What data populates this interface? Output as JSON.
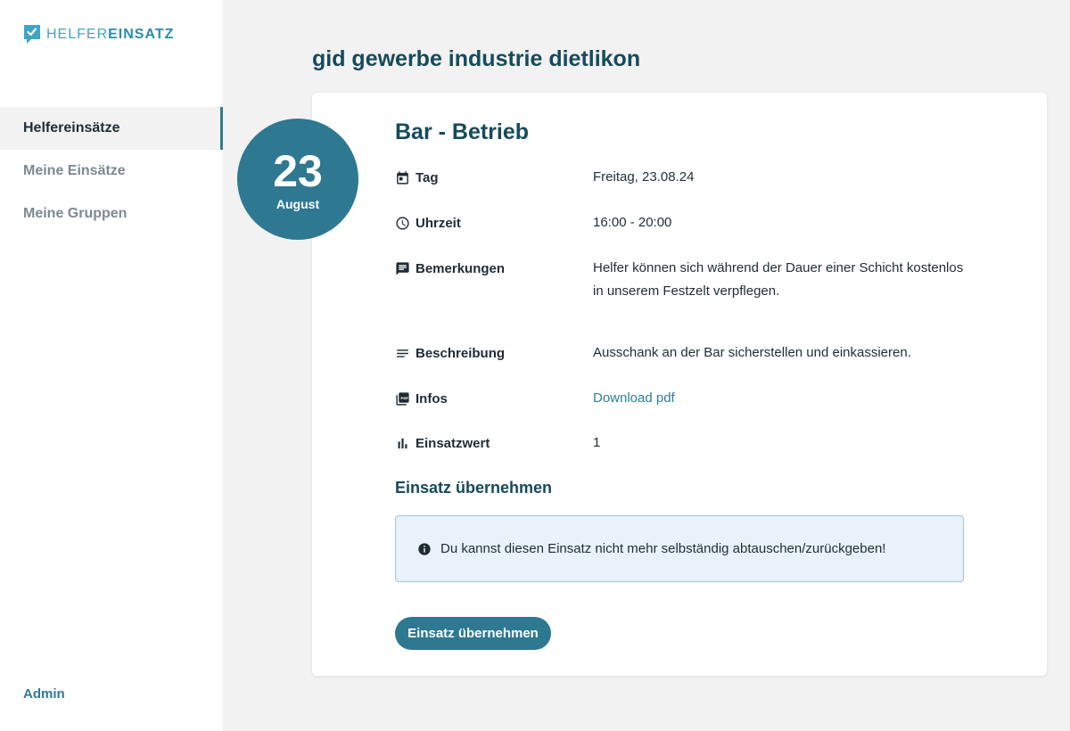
{
  "brand": {
    "name_light": "HELFER",
    "name_bold": "EINSATZ"
  },
  "sidebar": {
    "items": [
      {
        "label": "Helfereinsätze",
        "active": true
      },
      {
        "label": "Meine Einsätze",
        "active": false
      },
      {
        "label": "Meine Gruppen",
        "active": false
      }
    ],
    "admin_label": "Admin"
  },
  "page": {
    "title": "gid gewerbe industrie dietlikon"
  },
  "date_badge": {
    "day": "23",
    "month": "August"
  },
  "shift": {
    "title": "Bar - Betrieb",
    "details": [
      {
        "icon": "calendar-icon",
        "label": "Tag",
        "value": "Freitag, 23.08.24"
      },
      {
        "icon": "clock-icon",
        "label": "Uhrzeit",
        "value": "16:00 - 20:00"
      },
      {
        "icon": "comment-icon",
        "label": "Bemerkungen",
        "value": "Helfer können sich während der Dauer einer Schicht kostenlos in unserem Festzelt verpflegen."
      },
      {
        "icon": "description-icon",
        "label": "Beschreibung",
        "value": "Ausschank an der Bar sicherstellen und einkassieren."
      },
      {
        "icon": "pdf-icon",
        "label": "Infos",
        "value": "Download pdf"
      },
      {
        "icon": "bar-chart-icon",
        "label": "Einsatzwert",
        "value": "1"
      }
    ]
  },
  "take_over": {
    "section_title": "Einsatz übernehmen",
    "info_message": "Du kannst diesen Einsatz nicht mehr selbständig abtauschen/zurückgeben!",
    "button_label": "Einsatz übernehmen"
  },
  "colors": {
    "primary": "#2e7891",
    "heading": "#164a5b",
    "link": "#2b7f99",
    "info_bg": "#e9f2fb",
    "info_border": "#9fc6dc",
    "background": "#f2f2f2"
  }
}
